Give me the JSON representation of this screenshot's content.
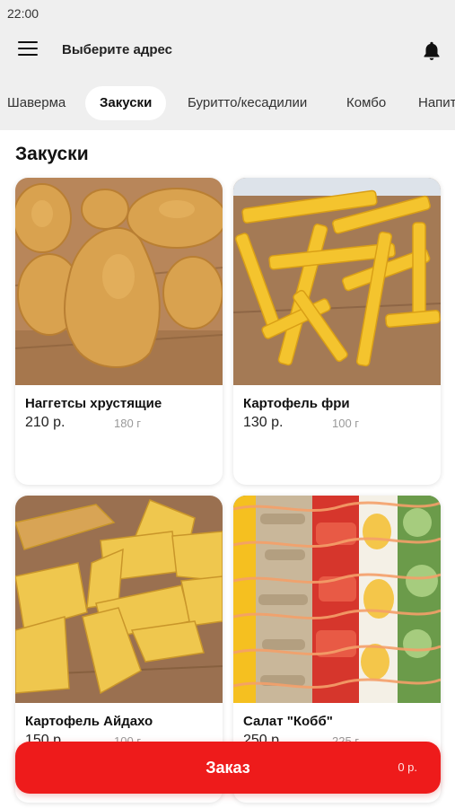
{
  "status_bar": {
    "time": "22:00"
  },
  "header": {
    "address_label": "Выберите адрес"
  },
  "tabs": [
    {
      "label": "Шаверма"
    },
    {
      "label": "Закуски",
      "active": true
    },
    {
      "label": "Буритто/кесадилии"
    },
    {
      "label": "Комбо"
    },
    {
      "label": "Напит"
    }
  ],
  "section": {
    "title": "Закуски"
  },
  "products": [
    {
      "name": "Наггетсы хрустящие",
      "price": "210 р.",
      "weight": "180 г",
      "image": "nuggets"
    },
    {
      "name": "Картофель фри",
      "price": "130 р.",
      "weight": "100 г",
      "image": "fries"
    },
    {
      "name": "Картофель Айдахо",
      "price": "150 р.",
      "weight": "100 г",
      "image": "potato-wedges"
    },
    {
      "name": "Салат \"Кобб\"",
      "price": "250 р.",
      "weight": "225 г",
      "image": "cobb-salad"
    }
  ],
  "order_bar": {
    "label": "Заказ",
    "total": "0 р."
  },
  "colors": {
    "accent": "#ee1b1b",
    "header_bg": "#efefef"
  }
}
